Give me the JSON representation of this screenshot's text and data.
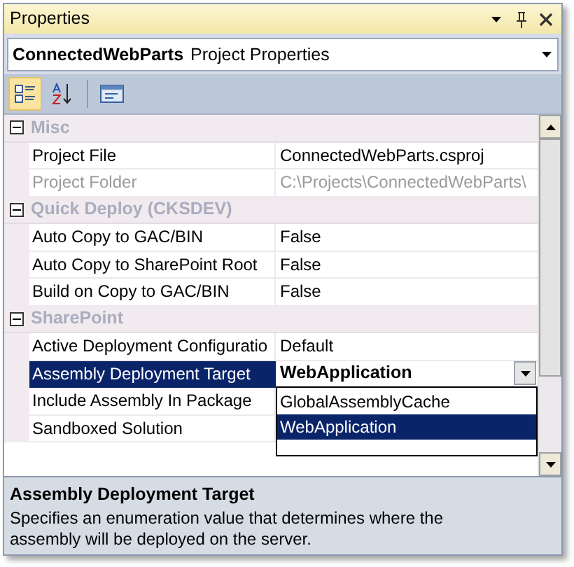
{
  "window": {
    "title": "Properties"
  },
  "object_selector": {
    "name": "ConnectedWebParts",
    "type": "Project Properties"
  },
  "toolbar": [
    {
      "kind": "categorized",
      "selected": true
    },
    {
      "kind": "alphabetical",
      "selected": false
    },
    {
      "kind": "property_pages",
      "selected": false
    }
  ],
  "categories": [
    {
      "name": "Misc",
      "expanded": true,
      "properties": [
        {
          "name": "Project File",
          "value": "ConnectedWebParts.csproj",
          "disabled": false,
          "selected": false
        },
        {
          "name": "Project Folder",
          "value": "C:\\Projects\\ConnectedWebParts\\",
          "disabled": true,
          "selected": false
        }
      ]
    },
    {
      "name": "Quick Deploy (CKSDEV)",
      "expanded": true,
      "properties": [
        {
          "name": "Auto Copy to GAC/BIN",
          "value": "False",
          "disabled": false,
          "selected": false
        },
        {
          "name": "Auto Copy to SharePoint Root",
          "value": "False",
          "disabled": false,
          "selected": false
        },
        {
          "name": "Build on Copy to GAC/BIN",
          "value": "False",
          "disabled": false,
          "selected": false
        }
      ]
    },
    {
      "name": "SharePoint",
      "expanded": true,
      "properties": [
        {
          "name": "Active Deployment Configuratio",
          "value": "Default",
          "disabled": false,
          "selected": false
        },
        {
          "name": "Assembly Deployment Target",
          "value": "WebApplication",
          "disabled": false,
          "selected": true,
          "dropdown": {
            "options": [
              {
                "label": "GlobalAssemblyCache",
                "selected": false
              },
              {
                "label": "WebApplication",
                "selected": true
              }
            ]
          }
        },
        {
          "name": "Include Assembly In Package",
          "disabled": false,
          "selected": false
        },
        {
          "name": "Sandboxed Solution",
          "disabled": false,
          "selected": false
        }
      ]
    }
  ],
  "description": {
    "title": "Assembly Deployment Target",
    "text": "Specifies an enumeration value that determines where the assembly will be deployed on the server."
  }
}
